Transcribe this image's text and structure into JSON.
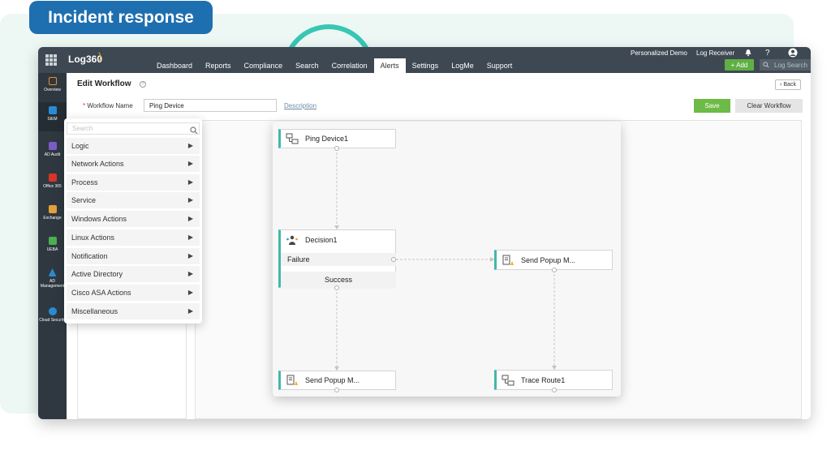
{
  "banner": {
    "title": "Incident response"
  },
  "topbar": {
    "product": "Log360",
    "nav": [
      "Dashboard",
      "Reports",
      "Compliance",
      "Search",
      "Correlation",
      "Alerts",
      "Settings",
      "LogMe",
      "Support"
    ],
    "active_nav": "Alerts",
    "personalized_demo": "Personalized Demo",
    "log_receiver": "Log Receiver",
    "help_label": "?",
    "add_label": "+ Add",
    "search_placeholder": "Log Search"
  },
  "sidebar": {
    "items": [
      {
        "label": "Overview",
        "icon": "overview-icon",
        "color": "#e8912d"
      },
      {
        "label": "SIEM",
        "icon": "siem-icon",
        "color": "#2a8ad4"
      },
      {
        "label": "AD Audit",
        "icon": "ad-audit-icon",
        "color": "#7a5cc8"
      },
      {
        "label": "Office 365",
        "icon": "office-365-icon",
        "color": "#d9342b"
      },
      {
        "label": "Exchange",
        "icon": "exchange-icon",
        "color": "#e3a13a"
      },
      {
        "label": "UEBA",
        "icon": "ueba-icon",
        "color": "#4caf50"
      },
      {
        "label": "AD Management",
        "icon": "ad-management-icon",
        "color": "#2a8ad4"
      },
      {
        "label": "Cloud Security",
        "icon": "cloud-security-icon",
        "color": "#2a8ad4"
      }
    ],
    "active": "SIEM"
  },
  "page": {
    "title": "Edit Workflow",
    "back_label": "Back",
    "workflow_name_label": "Workflow Name",
    "required_mark": "*",
    "workflow_name_value": "Ping Device",
    "description_link": "Description",
    "save_label": "Save",
    "clear_label": "Clear Workflow"
  },
  "palette": {
    "search_placeholder": "Search",
    "items": [
      "Logic",
      "Network Actions",
      "Process",
      "Service",
      "Windows Actions",
      "Linux Actions",
      "Notification",
      "Active Directory",
      "Cisco ASA Actions",
      "Miscellaneous"
    ]
  },
  "workflow": {
    "nodes": {
      "ping_device": "Ping Device1",
      "decision": "Decision1",
      "failure": "Failure",
      "success": "Success",
      "popup_right": "Send Popup M...",
      "popup_bottom": "Send Popup M...",
      "trace_route": "Trace Route1"
    }
  },
  "colors": {
    "accent_teal": "#42b8a8",
    "banner_blue": "#1e6fb0",
    "save_green": "#6dbb46",
    "topbar": "#3e4852"
  }
}
